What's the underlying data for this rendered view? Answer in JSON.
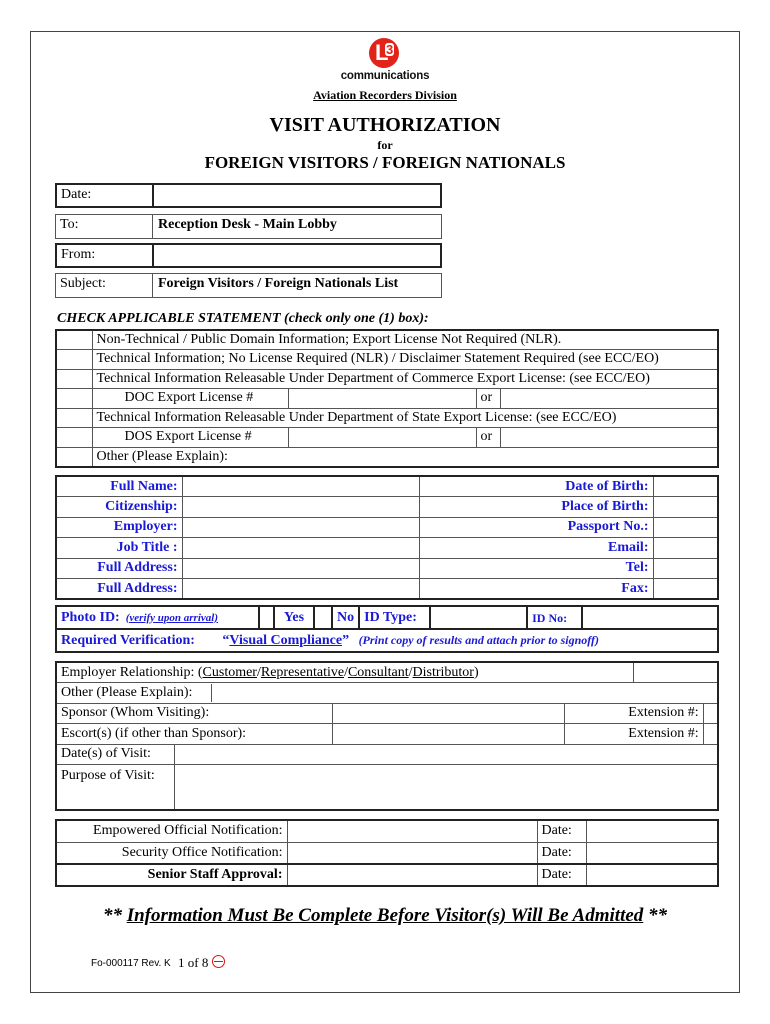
{
  "header": {
    "logo_mark": "L",
    "logo_mark_sub": "3",
    "logo_word": "communications",
    "division": "Aviation Recorders Division",
    "title": "VISIT AUTHORIZATION",
    "for": "for",
    "subtitle": "FOREIGN VISITORS / FOREIGN NATIONALS"
  },
  "memo": {
    "date_label": "Date:",
    "date_value": "",
    "to_label": "To:",
    "to_value": "Reception Desk - Main Lobby",
    "from_label": "From:",
    "from_value": "",
    "subject_label": "Subject:",
    "subject_value": "Foreign Visitors / Foreign Nationals List"
  },
  "statements": {
    "heading": "CHECK APPLICABLE STATEMENT (check only one (1) box):",
    "items": [
      "Non-Technical / Public Domain Information;  Export License Not Required (NLR).",
      "Technical Information;  No License Required (NLR) / Disclaimer Statement Required (see ECC/EO)",
      "Technical Information Releasable Under Department of Commerce Export License:  (see ECC/EO)",
      "DOC Export License #",
      "Technical Information Releasable Under Department of State Export License:  (see ECC/EO)",
      "DOS Export License #",
      "Other (Please Explain):"
    ],
    "or": "or"
  },
  "visitor": {
    "left_labels": [
      "Full Name:",
      "Citizenship:",
      "Employer:",
      "Job Title :",
      "Full Address:",
      "Full Address:"
    ],
    "right_labels": [
      "Date of Birth:",
      "Place of Birth:",
      "Passport No.:",
      "Email:",
      "Tel:",
      "Fax:"
    ]
  },
  "photo_id": {
    "label": "Photo ID:",
    "note": "(verify upon arrival)",
    "yes": "Yes",
    "no": "No",
    "id_type": "ID Type:",
    "id_no": "ID No:",
    "required_label": "Required Verification:",
    "visual_open": "“",
    "visual": "Visual Compliance",
    "visual_close": "”",
    "visual_note": "(Print copy of results and attach prior to signoff)"
  },
  "visit": {
    "relationship_label": "Employer Relationship:  (",
    "relationship_options": [
      "Customer",
      "Representative",
      "Consultant",
      "Distributor"
    ],
    "relationship_sep": "/",
    "relationship_close": ")",
    "other_label": "Other (Please Explain):",
    "sponsor_label": "Sponsor   (Whom Visiting):",
    "escort_label": "Escort(s)  (if other than Sponsor):",
    "extension_label": "Extension #:",
    "dates_label": "Date(s) of Visit:",
    "purpose_label": "Purpose of Visit:"
  },
  "approvals": {
    "rows": [
      {
        "label": "Empowered Official Notification:",
        "date": "Date:"
      },
      {
        "label": "Security Office Notification:",
        "date": "Date:"
      },
      {
        "label": "Senior Staff Approval:",
        "date": "Date:"
      }
    ]
  },
  "footer": {
    "stars_left": "** ",
    "notice": "Information Must Be Complete Before Visitor(s) Will Be Admitted",
    "stars_right": " **",
    "form_no": "Fo-000117 Rev. K",
    "page": "1 of 8",
    "page_icon": "no-entry-icon"
  },
  "colors": {
    "accent_blue": "#1a1ad6",
    "logo_red": "#e2231a"
  }
}
